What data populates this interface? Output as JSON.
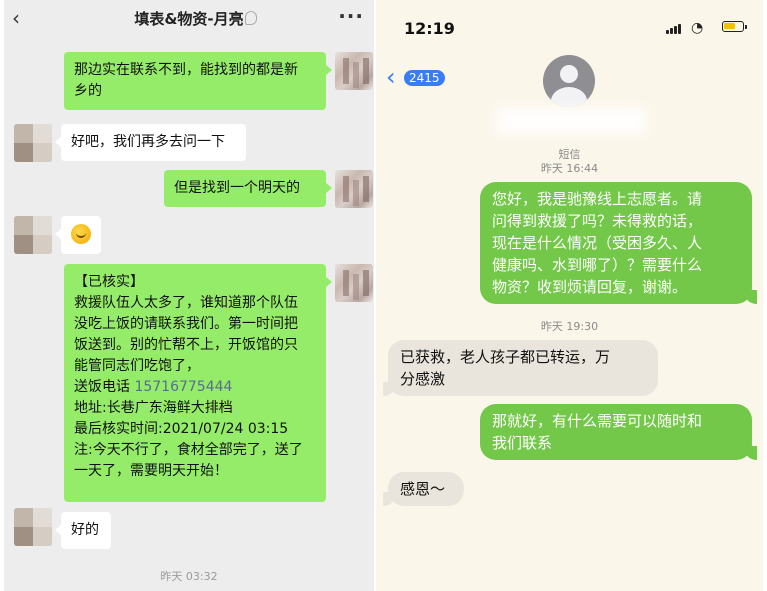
{
  "wechat": {
    "back_icon": "chevron-left-icon",
    "title": "填表&物资-月亮",
    "more_label": "···",
    "messages": [
      {
        "side": "right",
        "text_lines": [
          "那边实在联系不到，能找到的都是新",
          "乡的"
        ]
      },
      {
        "side": "left",
        "text": "好吧，我们再多去问一下"
      },
      {
        "side": "right",
        "text": "但是找到一个明天的"
      },
      {
        "side": "left",
        "emoji": "smile-emoji-icon"
      },
      {
        "side": "right",
        "text_lines": [
          "【已核实】",
          "救援队伍人太多了，谁知道那个队伍",
          "没吃上饭的请联系我们。第一时间把",
          "饭送到。别的忙帮不上，开饭馆的只",
          "能管同志们吃饱了，",
          "送饭电话 ",
          "15716775444",
          "地址:长巷广东海鲜大排档",
          "最后核实时间:2021/07/24  03:15",
          "注:今天不行了，食材全部完了，送了",
          "一天了，需要明天开始！"
        ]
      },
      {
        "side": "left",
        "text": "好的"
      }
    ],
    "timestamp": "昨天 03:32"
  },
  "imessage": {
    "status_time": "12:19",
    "back_count": "2415",
    "label_sms": "短信",
    "time1": "昨天 16:44",
    "time2": "昨天 19:30",
    "messages": [
      {
        "side": "right",
        "text_lines": [
          "您好，我是驰豫线上志愿者。请",
          "问得到救援了吗？未得救的话，",
          "现在是什么情况（受困多久、人",
          "健康吗、水到哪了）？需要什么",
          "物资？收到烦请回复，谢谢。"
        ]
      },
      {
        "side": "left",
        "text_lines": [
          "已获救，老人孩子都已转运，万",
          "分感激"
        ]
      },
      {
        "side": "right",
        "text_lines": [
          "那就好，有什么需要可以随时和",
          "我们联系"
        ]
      },
      {
        "side": "left",
        "text": "感恩～"
      }
    ],
    "colors": {
      "sent_bubble": "#73c749",
      "received_bubble": "#e9e5dc",
      "accent": "#3a7cf2"
    }
  },
  "colors": {
    "wechat_green": "#95ec69",
    "wechat_bg": "#ededed",
    "imessage_bg": "#fbf6ea"
  }
}
